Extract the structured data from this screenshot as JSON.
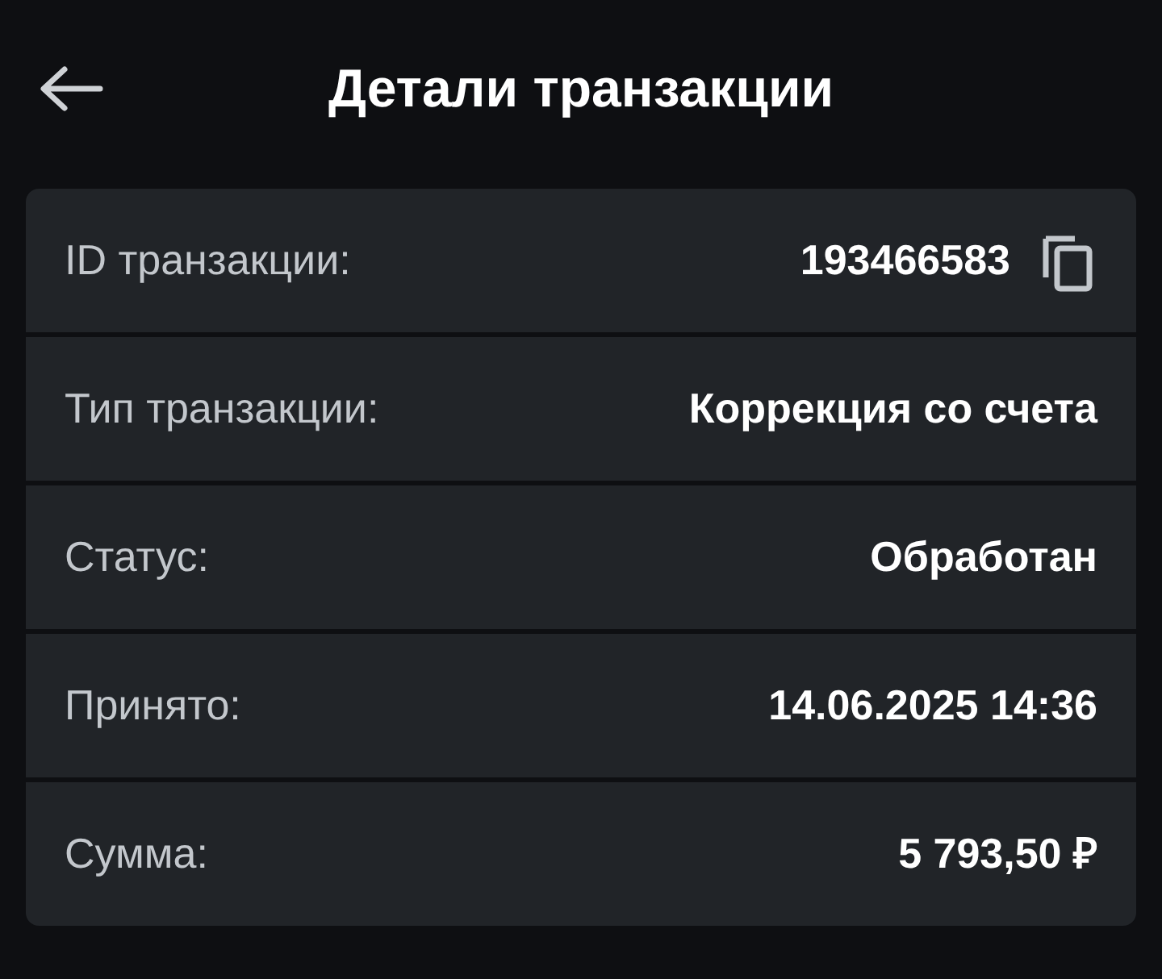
{
  "header": {
    "title": "Детали транзакции"
  },
  "rows": [
    {
      "label": "ID транзакции:",
      "value": "193466583",
      "copyable": true
    },
    {
      "label": "Тип транзакции:",
      "value": "Коррекция со счета",
      "copyable": false
    },
    {
      "label": "Статус:",
      "value": "Обработан",
      "copyable": false
    },
    {
      "label": "Принято:",
      "value": "14.06.2025 14:36",
      "copyable": false
    },
    {
      "label": "Сумма:",
      "value": "5 793,50 ₽",
      "copyable": false
    }
  ]
}
